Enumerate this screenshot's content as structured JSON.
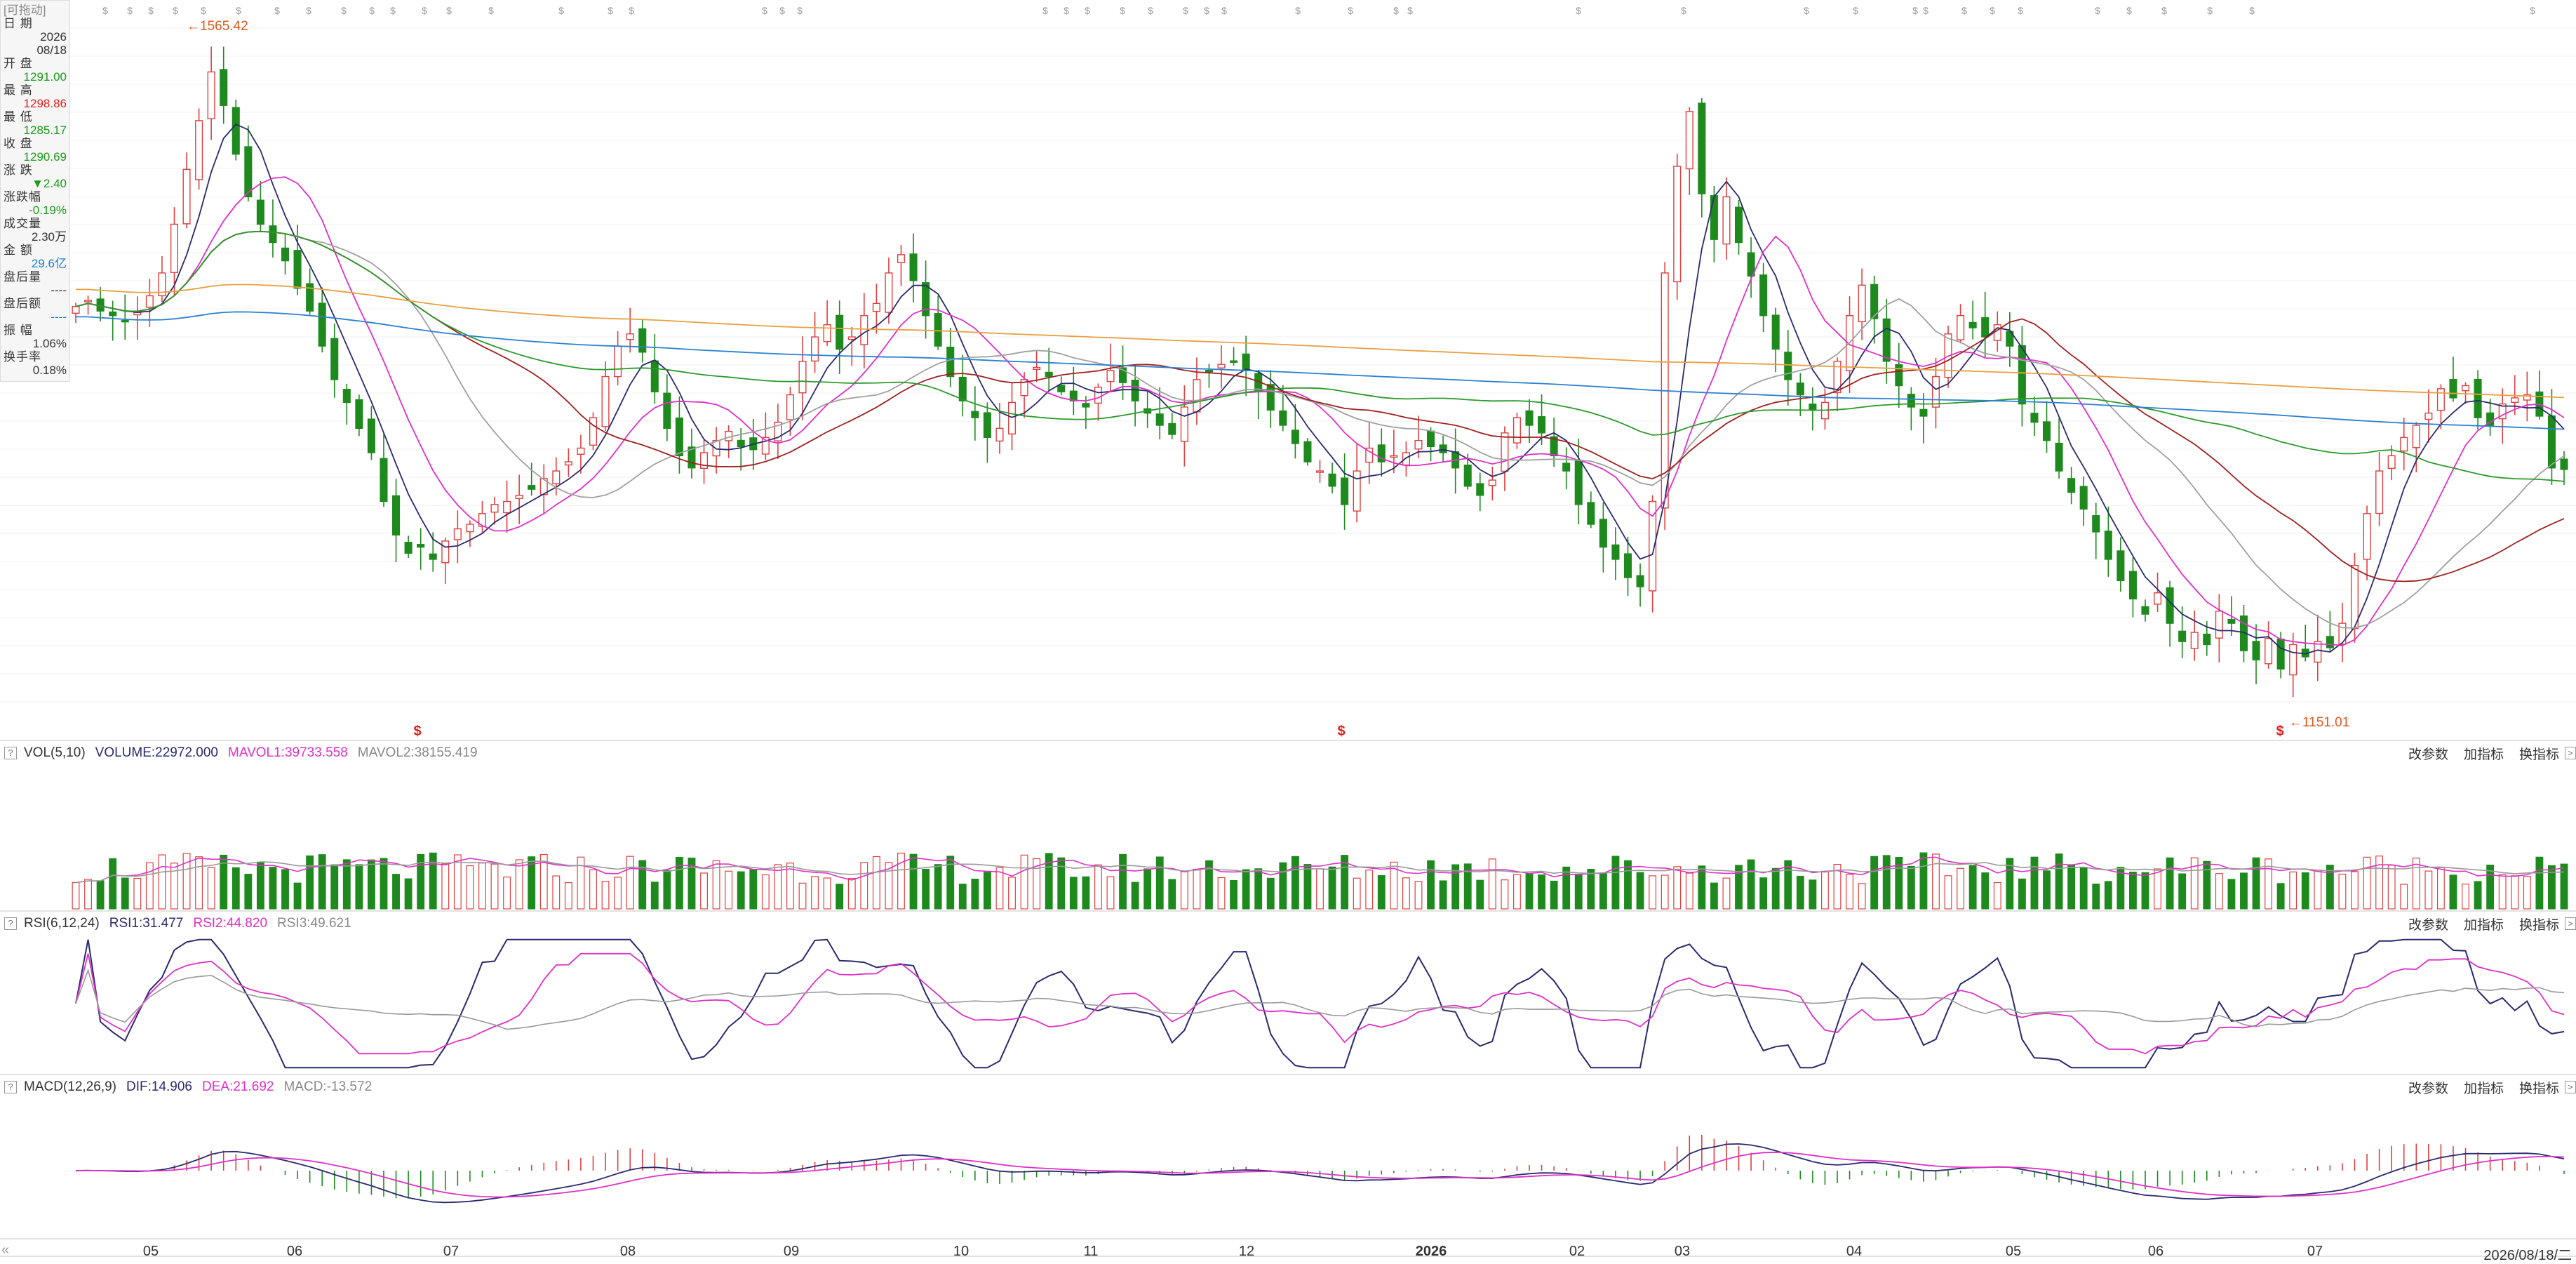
{
  "info_panel": {
    "tag": "[可拖动]",
    "rows": [
      {
        "label": "日  期",
        "value": "2026\n08/18",
        "color": "#333333"
      },
      {
        "label": "开  盘",
        "value": "1291.00",
        "color": "#1a9a1a"
      },
      {
        "label": "最  高",
        "value": "1298.86",
        "color": "#e02020"
      },
      {
        "label": "最  低",
        "value": "1285.17",
        "color": "#1a9a1a"
      },
      {
        "label": "收  盘",
        "value": "1290.69",
        "color": "#1a9a1a"
      },
      {
        "label": "涨  跌",
        "value": "▼2.40",
        "color": "#1a9a1a"
      },
      {
        "label": "涨跌幅",
        "value": "-0.19%",
        "color": "#1a9a1a"
      },
      {
        "label": "成交量",
        "value": "2.30万",
        "color": "#333333"
      },
      {
        "label": "金  额",
        "value": "29.6亿",
        "color": "#1a7fd0"
      },
      {
        "label": "盘后量",
        "value": "----",
        "color": "#333333"
      },
      {
        "label": "盘后额",
        "value": "----",
        "color": "#1a7fd0"
      },
      {
        "label": "振  幅",
        "value": "1.06%",
        "color": "#333333"
      },
      {
        "label": "换手率",
        "value": "0.18%",
        "color": "#333333"
      }
    ]
  },
  "extremes": {
    "high_label": "←1565.42",
    "low_label": "←1151.01"
  },
  "event_marker": "$",
  "indicator_tools": {
    "params": "改参数",
    "add": "加指标",
    "switch": "换指标",
    "arrow": ">"
  },
  "vol_bar": {
    "name": "VOL(5,10)",
    "items": [
      "VOLUME:22972.000",
      "MAVOL1:39733.558",
      "MAVOL2:38155.419"
    ],
    "help": "?"
  },
  "rsi_bar": {
    "name": "RSI(6,12,24)",
    "items": [
      "RSI1:31.477",
      "RSI2:44.820",
      "RSI3:49.621"
    ],
    "help": "?"
  },
  "macd_bar": {
    "name": "MACD(12,26,9)",
    "items": [
      "DIF:14.906",
      "DEA:21.692",
      "MACD:-13.572"
    ],
    "help": "?"
  },
  "x_axis": {
    "ticks": [
      "05",
      "06",
      "07",
      "08",
      "09",
      "10",
      "11",
      "12",
      "2026",
      "02",
      "03",
      "04",
      "05",
      "06",
      "07"
    ],
    "end_label": "2026/08/18/二",
    "start_label": "«"
  },
  "colors": {
    "up": "#e04040",
    "down": "#1e8a1e",
    "ma5": "#2a2a6e",
    "ma10": "#e030c8",
    "ma20": "#a0a0a0",
    "ma30": "#a02020",
    "ma60": "#2a9a2a",
    "ma120": "#2a80d0",
    "ma250": "#e8a040",
    "ind1": "#2a2a6e",
    "ind2": "#e030c8",
    "ind3": "#999999"
  },
  "chart_data": {
    "type": "candlestick",
    "y_range": [
      1151.01,
      1565.42
    ],
    "period_high": 1565.42,
    "period_low": 1151.01,
    "latest": {
      "date": "2026/08/18",
      "open": 1291.0,
      "high": 1298.86,
      "low": 1285.17,
      "close": 1290.69,
      "change": -2.4,
      "change_pct": -0.19,
      "amplitude_pct": 1.06,
      "turnover_pct": 0.18
    },
    "close_series": [
      1398,
      1402,
      1395,
      1392,
      1388,
      1394,
      1405,
      1420,
      1452,
      1488,
      1520,
      1552,
      1530,
      1498,
      1470,
      1452,
      1440,
      1428,
      1410,
      1395,
      1372,
      1350,
      1335,
      1318,
      1302,
      1270,
      1248,
      1236,
      1240,
      1232,
      1244,
      1252,
      1255,
      1262,
      1268,
      1270,
      1274,
      1278,
      1285,
      1290,
      1296,
      1305,
      1325,
      1352,
      1372,
      1380,
      1368,
      1342,
      1318,
      1300,
      1292,
      1302,
      1310,
      1316,
      1306,
      1304,
      1312,
      1322,
      1340,
      1362,
      1378,
      1386,
      1370,
      1378,
      1392,
      1400,
      1420,
      1432,
      1415,
      1392,
      1372,
      1352,
      1336,
      1325,
      1312,
      1318,
      1335,
      1350,
      1358,
      1352,
      1342,
      1336,
      1332,
      1345,
      1356,
      1348,
      1336,
      1328,
      1320,
      1314,
      1332,
      1350,
      1356,
      1360,
      1362,
      1356,
      1342,
      1330,
      1320,
      1308,
      1296,
      1290,
      1280,
      1268,
      1290,
      1305,
      1296,
      1300,
      1302,
      1310,
      1306,
      1302,
      1292,
      1280,
      1274,
      1284,
      1315,
      1325,
      1320,
      1315,
      1300,
      1290,
      1268,
      1255,
      1240,
      1232,
      1220,
      1214,
      1270,
      1420,
      1490,
      1526,
      1472,
      1442,
      1470,
      1440,
      1418,
      1392,
      1370,
      1350,
      1340,
      1330,
      1335,
      1362,
      1392,
      1412,
      1390,
      1362,
      1346,
      1332,
      1326,
      1352,
      1380,
      1392,
      1384,
      1378,
      1386,
      1372,
      1334,
      1322,
      1310,
      1290,
      1276,
      1265,
      1250,
      1232,
      1218,
      1206,
      1196,
      1210,
      1190,
      1178,
      1184,
      1176,
      1198,
      1190,
      1172,
      1166,
      1180,
      1160,
      1176,
      1168,
      1178,
      1174,
      1190,
      1228,
      1262,
      1290,
      1300,
      1312,
      1320,
      1328,
      1344,
      1338,
      1346,
      1325,
      1320,
      1334,
      1338,
      1340,
      1326,
      1292,
      1291
    ],
    "ma_periods": [
      5,
      10,
      20,
      30,
      60,
      120,
      250
    ],
    "indicators": {
      "VOL": {
        "volume": 22972.0,
        "mavol1": 39733.558,
        "mavol2": 38155.419
      },
      "RSI": {
        "rsi1": 31.477,
        "rsi2": 44.82,
        "rsi3": 49.621
      },
      "MACD": {
        "dif": 14.906,
        "dea": 21.692,
        "macd": -13.572
      }
    }
  }
}
